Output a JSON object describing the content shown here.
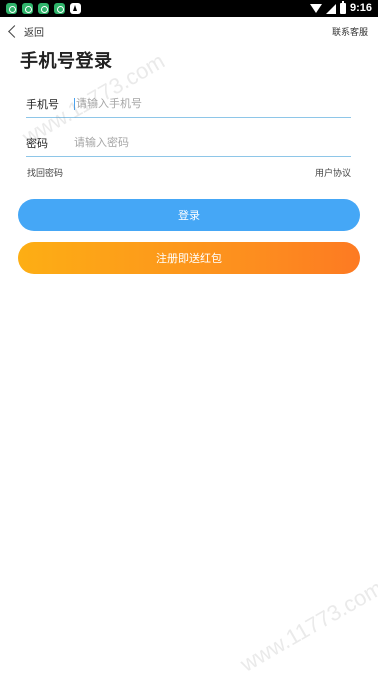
{
  "status_bar": {
    "time": "9:16",
    "app_icons": [
      "app-notification-icon",
      "app-notification-icon",
      "app-notification-icon",
      "app-notification-icon",
      "a-letter-icon"
    ]
  },
  "topbar": {
    "back_label": "返回",
    "service_label": "联系客服"
  },
  "title": "手机号登录",
  "form": {
    "phone_label": "手机号",
    "phone_placeholder": "请输入手机号",
    "password_label": "密码",
    "password_placeholder": "请输入密码"
  },
  "links": {
    "forgot": "找回密码",
    "agreement": "用户协议"
  },
  "buttons": {
    "login": "登录",
    "register": "注册即送红包"
  },
  "watermark": "www.11773.com",
  "colors": {
    "login_button": "#45a7f6",
    "register_gradient_start": "#fdae14",
    "register_gradient_end": "#fd7a22",
    "input_underline": "#8ec6e8"
  }
}
